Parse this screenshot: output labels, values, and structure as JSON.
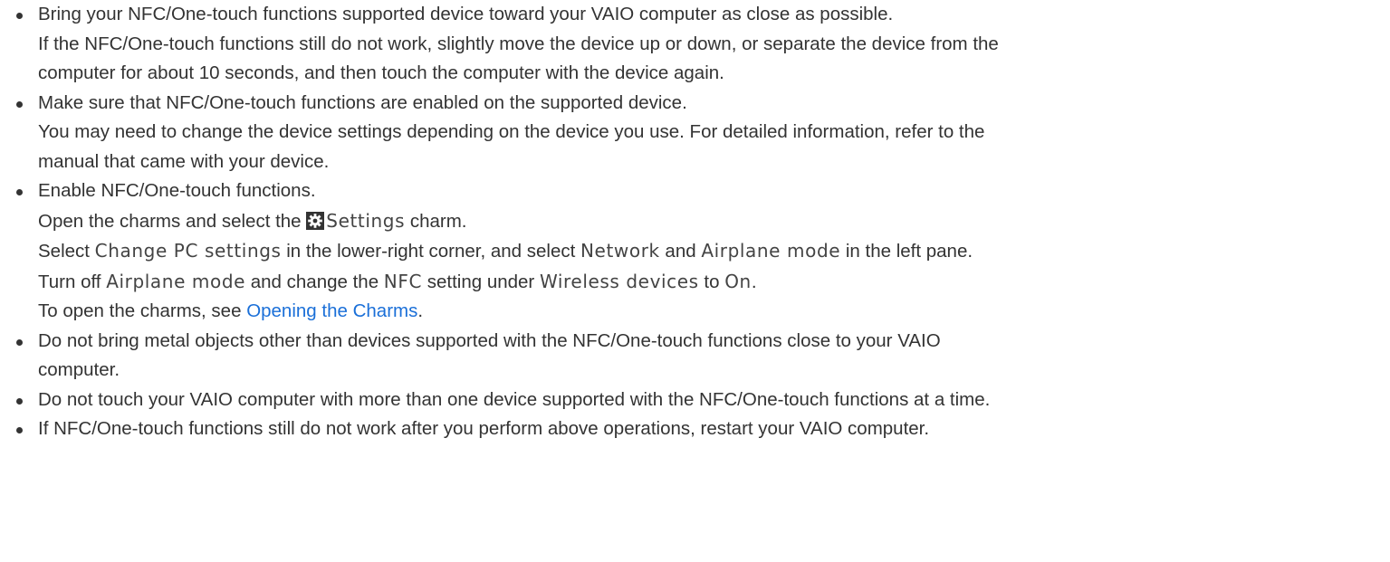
{
  "colors": {
    "text": "#333333",
    "link": "#1a6fd8",
    "ui_term": "#444444",
    "gear_icon_bg": "#333333"
  },
  "items": [
    {
      "lines": [
        "Bring your NFC/One-touch functions supported device toward your VAIO computer as close as possible.",
        "If the NFC/One-touch functions still do not work, slightly move the device up or down, or separate the device from the",
        "computer for about 10 seconds, and then touch the computer with the device again."
      ]
    },
    {
      "lines": [
        "Make sure that NFC/One-touch functions are enabled on the supported device.",
        "You may need to change the device settings depending on the device you use. For detailed information, refer to the",
        "manual that came with your device."
      ]
    },
    {
      "line1": "Enable NFC/One-touch functions.",
      "line2": {
        "pre": "Open the charms and select the ",
        "icon": "gear-icon",
        "term": "Settings",
        "post": " charm."
      },
      "line3": {
        "pre": "Select ",
        "term1": "Change PC settings",
        "mid1": " in the lower-right corner, and select ",
        "term2": "Network",
        "mid2": " and ",
        "term3": "Airplane mode",
        "post": " in the left pane."
      },
      "line4": {
        "pre": "Turn off ",
        "term1": "Airplane mode",
        "mid1": " and change the ",
        "term2": "NFC",
        "mid2": " setting under ",
        "term3": "Wireless devices",
        "mid3": " to ",
        "term4": "On",
        "post": "."
      },
      "line5": {
        "pre": "To open the charms, see ",
        "link": "Opening the Charms",
        "post": "."
      }
    },
    {
      "lines": [
        "Do not bring metal objects other than devices supported with the NFC/One-touch functions close to your VAIO",
        "computer."
      ]
    },
    {
      "lines": [
        "Do not touch your VAIO computer with more than one device supported with the NFC/One-touch functions at a time."
      ]
    },
    {
      "lines": [
        "If NFC/One-touch functions still do not work after you perform above operations, restart your VAIO computer."
      ]
    }
  ]
}
